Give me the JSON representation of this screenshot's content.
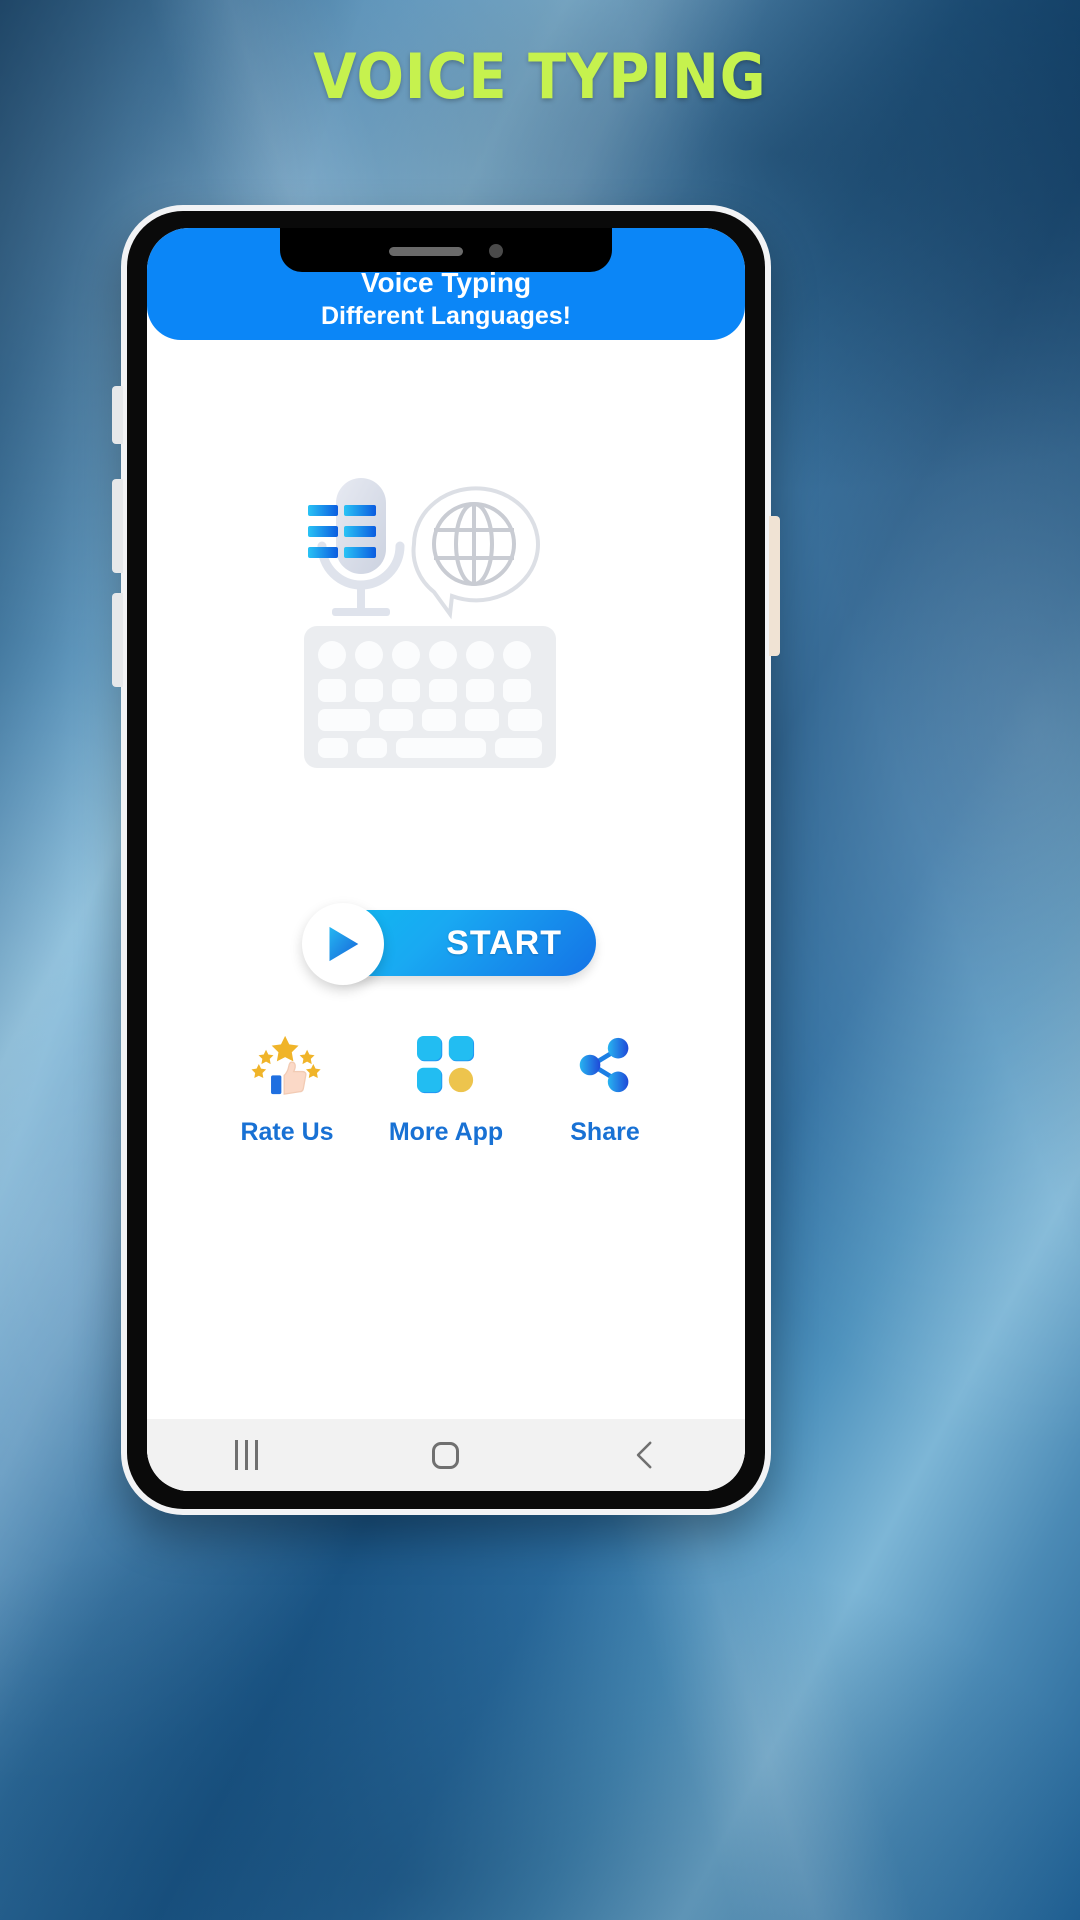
{
  "headline": "VOICE TYPING",
  "colors": {
    "headline": "#c6f24e",
    "header_bar": "#0b86f7",
    "accent_blue": "#1871d4",
    "start_gradient_from": "#0fb9f0",
    "start_gradient_to": "#1473e6",
    "nav_bar": "#f2f2f2",
    "phone_frame": "#0a0a0a"
  },
  "app": {
    "header": {
      "title": "Voice Typing",
      "subtitle": "Different Languages!"
    },
    "hero": {
      "mic_icon": "microphone-icon",
      "globe_icon": "globe-speech-bubble-icon",
      "keyboard_icon": "keyboard-icon"
    },
    "start_button": {
      "label": "START",
      "play_icon": "play-icon"
    },
    "actions": [
      {
        "label": "Rate Us",
        "icon": "thumbs-up-stars-icon"
      },
      {
        "label": "More App",
        "icon": "grid-squares-icon"
      },
      {
        "label": "Share",
        "icon": "share-nodes-icon"
      }
    ],
    "navbar": [
      {
        "name": "recents",
        "icon": "recents-icon"
      },
      {
        "name": "home",
        "icon": "home-icon"
      },
      {
        "name": "back",
        "icon": "back-chevron-icon"
      }
    ]
  }
}
